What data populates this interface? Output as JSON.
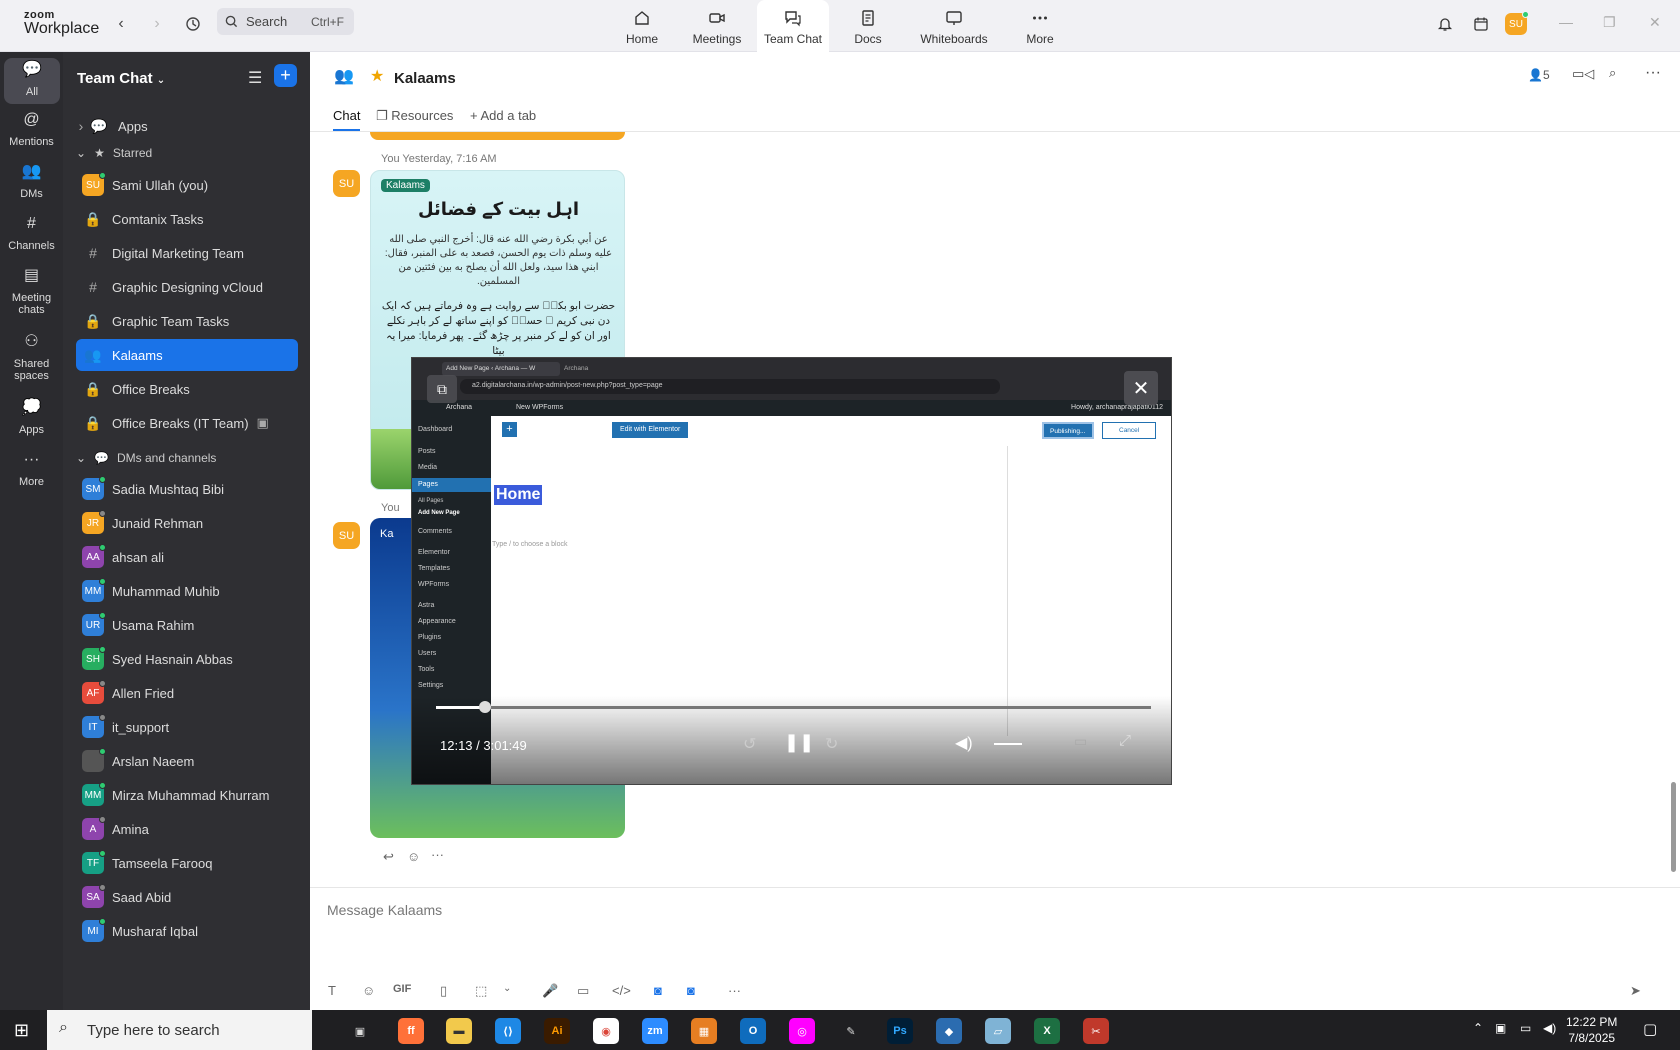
{
  "app": {
    "brand_top": "zoom",
    "brand_bottom": "Workplace",
    "search_placeholder": "Search",
    "search_shortcut": "Ctrl+F",
    "avatar": "SU"
  },
  "nav_tabs": [
    {
      "label": "Home"
    },
    {
      "label": "Meetings"
    },
    {
      "label": "Team Chat"
    },
    {
      "label": "Docs"
    },
    {
      "label": "Whiteboards"
    },
    {
      "label": "More"
    }
  ],
  "rail": [
    {
      "label": "All"
    },
    {
      "label": "Mentions"
    },
    {
      "label": "DMs"
    },
    {
      "label": "Channels"
    },
    {
      "label": "Meeting chats"
    },
    {
      "label": "Shared spaces"
    },
    {
      "label": "Apps"
    },
    {
      "label": "More"
    }
  ],
  "sidebar": {
    "title": "Team Chat",
    "apps_label": "Apps",
    "starred_label": "Starred",
    "starred": [
      {
        "label": "Sami Ullah (you)",
        "avatar": "SU"
      },
      {
        "label": "Comtanix Tasks"
      },
      {
        "label": "Digital Marketing Team"
      },
      {
        "label": "Graphic Designing vCloud"
      },
      {
        "label": "Graphic Team Tasks"
      },
      {
        "label": "Kalaams"
      },
      {
        "label": "Office Breaks"
      },
      {
        "label": "Office Breaks (IT Team)"
      }
    ],
    "dms_label": "DMs and channels",
    "dms": [
      {
        "label": "Sadia Mushtaq Bibi",
        "avatar": "SM",
        "color": "#2f7fd8"
      },
      {
        "label": "Junaid Rehman",
        "avatar": "JR",
        "color": "#f5a623"
      },
      {
        "label": "ahsan ali",
        "avatar": "AA",
        "color": "#8e44ad"
      },
      {
        "label": "Muhammad Muhib",
        "avatar": "MM",
        "color": "#2f7fd8"
      },
      {
        "label": "Usama Rahim",
        "avatar": "UR",
        "color": "#2f7fd8"
      },
      {
        "label": "Syed Hasnain Abbas",
        "avatar": "SH",
        "color": "#27ae60"
      },
      {
        "label": "Allen Fried",
        "avatar": "AF",
        "color": "#e74c3c"
      },
      {
        "label": "it_support",
        "avatar": "IT",
        "color": "#2f7fd8"
      },
      {
        "label": "Arslan Naeem",
        "avatar": "",
        "color": "#555"
      },
      {
        "label": "Mirza Muhammad Khurram",
        "avatar": "MM",
        "color": "#16a085"
      },
      {
        "label": "Amina",
        "avatar": "A",
        "color": "#8e44ad"
      },
      {
        "label": "Tamseela Farooq",
        "avatar": "TF",
        "color": "#16a085"
      },
      {
        "label": "Saad Abid",
        "avatar": "SA",
        "color": "#8e44ad"
      },
      {
        "label": "Musharaf Iqbal",
        "avatar": "MI",
        "color": "#2f7fd8"
      }
    ]
  },
  "channel": {
    "name": "Kalaams",
    "members": "5",
    "tabs": [
      "Chat",
      "Resources",
      "Add a tab"
    ]
  },
  "messages": [
    {
      "avatar": "SU",
      "meta": "You Yesterday, 7:16 AM",
      "image_title": "اہل بیت کے فضائل",
      "image_brand": "Kalaams",
      "image_arabic": "عن أبي بكرة رضي الله عنه قال: أخرج النبي صلى الله عليه وسلم ذات يوم الحسن، فصعد به على المنبر، فقال: ابني هذا سيد، ولعل الله أن يصلح به بين فئتين من المسلمين.",
      "image_urdu": "حضرت ابو بکرؓ سے روایت ہے وہ فرماتے ہیں کہ ایک دن نبی کریم ﷺ حسنؓ کو اپنے ساتھ لے کر باہر نکلے اور ان کو لے کر منبر پر چڑھ گئے۔ پھر فرمایا: میرا یہ بیٹا"
    },
    {
      "avatar": "SU",
      "meta": "You",
      "image_brand": "Ka"
    }
  ],
  "composer": {
    "placeholder": "Message Kalaams",
    "gif": "GIF"
  },
  "video": {
    "time": "12:13 / 3:01:49",
    "progress": 0.068,
    "browser_tab": "Add New Page ‹ Archana — W",
    "browser_tab2": "Archana",
    "url": "a2.digitalarchana.in/wp-admin/post-new.php?post_type=page",
    "wp_site": "Archana",
    "wp_new": "New",
    "wp_forms": "WPForms",
    "wp_howdy": "Howdy, archanaprajapati0112",
    "edit_btn": "Edit with Elementor",
    "publishing": "Publishing...",
    "cancel": "Cancel",
    "page_title": "Home",
    "block_hint": "Type / to choose a block",
    "menu": [
      "Dashboard",
      "Posts",
      "Media",
      "Pages",
      "All Pages",
      "Add New Page",
      "Comments",
      "Elementor",
      "Templates",
      "WPForms",
      "Astra",
      "Appearance",
      "Plugins",
      "Users",
      "Tools",
      "Settings"
    ]
  },
  "taskbar": {
    "search": "Type here to search",
    "time": "12:22 PM",
    "date": "7/8/2025"
  }
}
